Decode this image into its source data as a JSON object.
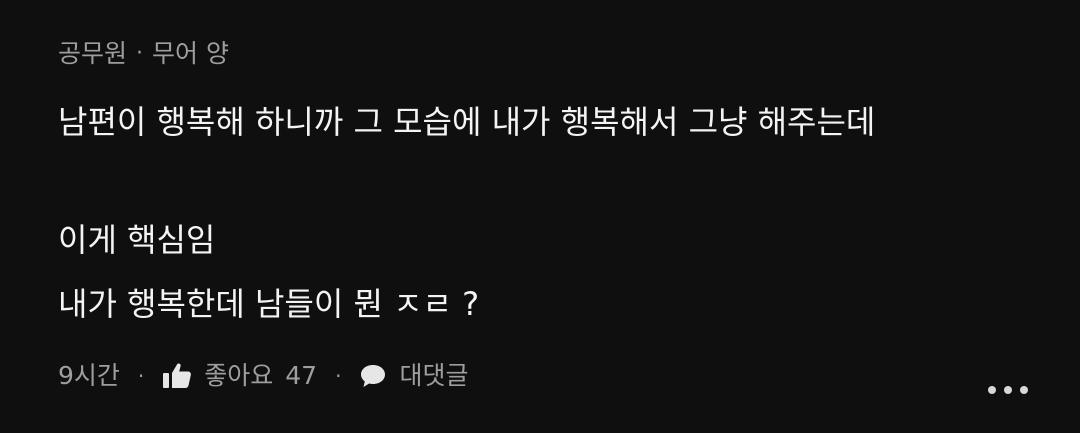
{
  "comment": {
    "author": "공무원",
    "separator": "·",
    "nickname": "무어 양",
    "lines": [
      "남편이 행복해 하니까 그 모습에 내가 행복해서 그냥 해주는데",
      "이게 핵심임",
      "내가 행복한데 남들이 뭔 ㅈㄹ ?"
    ],
    "time": "9시간",
    "like_label": "좋아요",
    "like_count": "47",
    "reply_label": "대댓글",
    "icons": {
      "like": "thumbs-up-icon",
      "reply": "speech-bubble-icon",
      "more": "more-horizontal-icon"
    }
  }
}
